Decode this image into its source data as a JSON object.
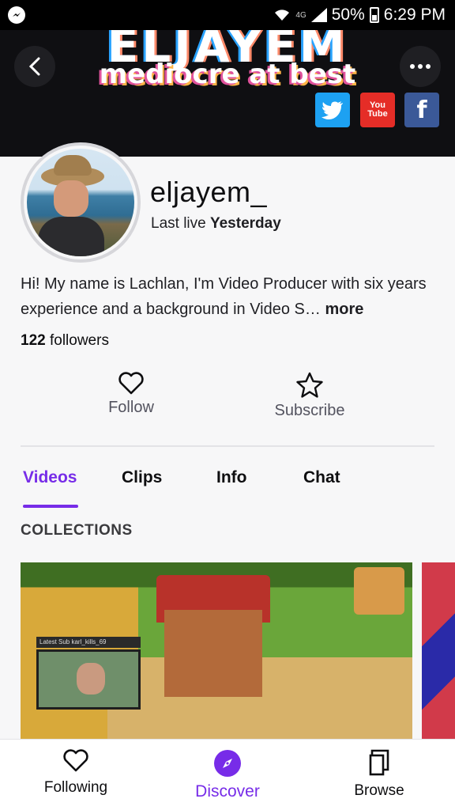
{
  "status_bar": {
    "battery": "50%",
    "time": "6:29 PM",
    "network": "4G"
  },
  "banner": {
    "title": "ELJAYEM",
    "subtitle": "mediocre at best",
    "social": {
      "twitter_icon": "twitter-icon",
      "youtube_line1": "You",
      "youtube_line2": "Tube",
      "facebook_label": "f"
    }
  },
  "profile": {
    "username": "eljayem_",
    "last_live_prefix": "Last live",
    "last_live_value": "Yesterday",
    "bio": "Hi! My name is Lachlan, I'm Video Producer with six years experience and a background in Video S…",
    "bio_more": "more",
    "followers_count": "122",
    "followers_label": "followers"
  },
  "actions": {
    "follow_label": "Follow",
    "subscribe_label": "Subscribe"
  },
  "tabs": [
    {
      "label": "Videos",
      "active": true
    },
    {
      "label": "Clips",
      "active": false
    },
    {
      "label": "Info",
      "active": false
    },
    {
      "label": "Chat",
      "active": false
    }
  ],
  "collections": {
    "title": "COLLECTIONS",
    "thumbnail_sub_text": "Latest Sub  karl_kills_69"
  },
  "bottom_nav": [
    {
      "label": "Following",
      "icon": "heart-icon",
      "active": false
    },
    {
      "label": "Discover",
      "icon": "compass-icon",
      "active": true
    },
    {
      "label": "Browse",
      "icon": "copy-icon",
      "active": false
    }
  ],
  "colors": {
    "accent": "#772ce8",
    "twitter": "#1da1f2",
    "youtube": "#e52d27",
    "facebook": "#3b5998"
  }
}
